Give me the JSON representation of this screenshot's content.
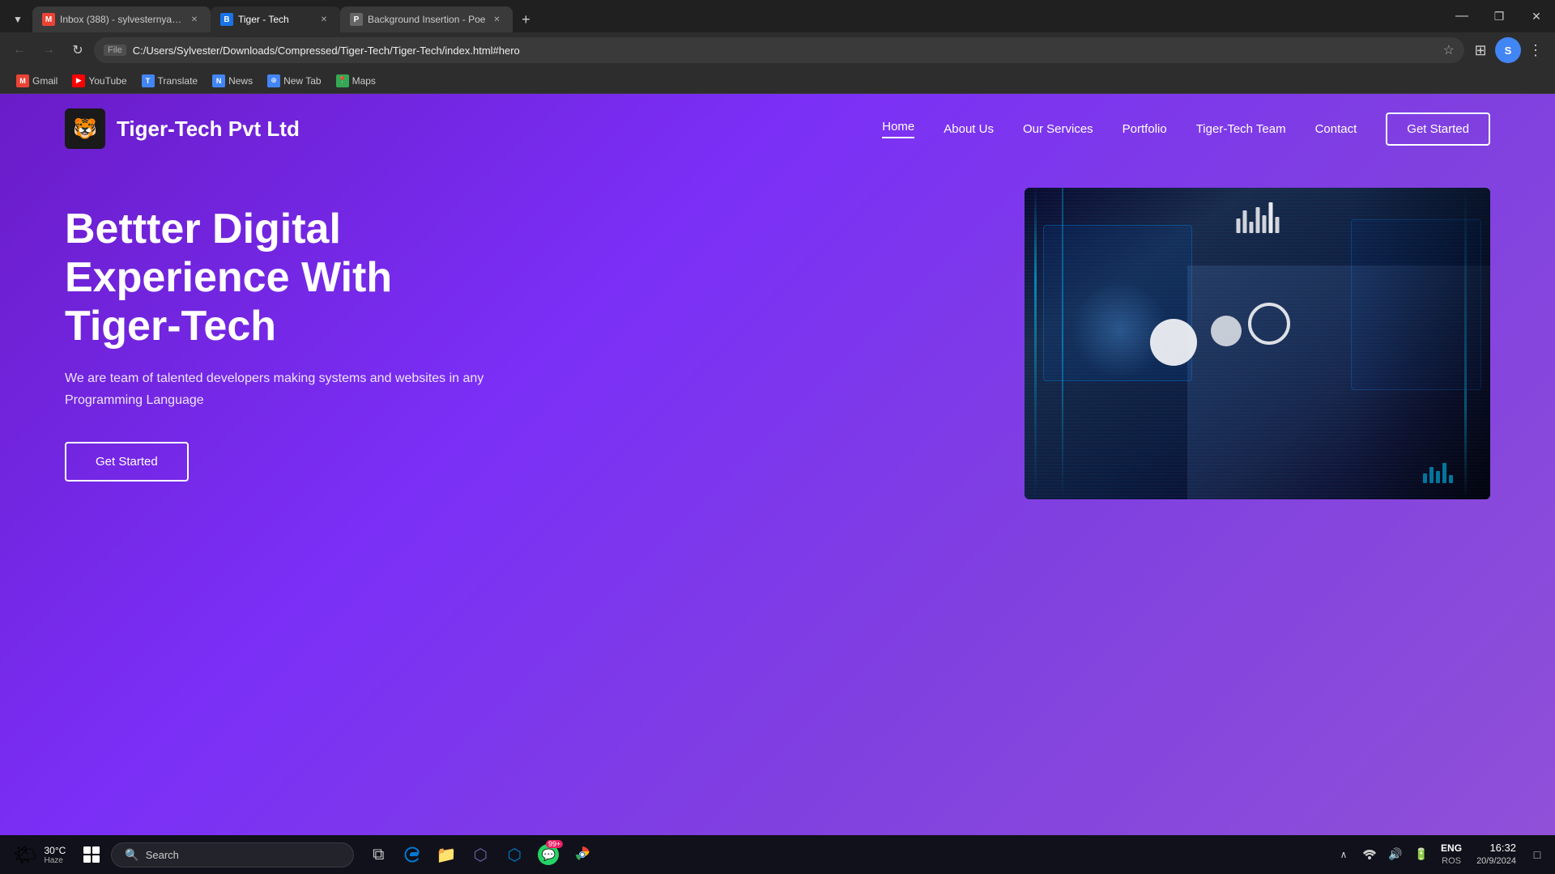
{
  "browser": {
    "tabs": [
      {
        "id": "gmail",
        "label": "Inbox (388) - sylvesternyamuru...",
        "favicon_char": "M",
        "favicon_bg": "#ea4335",
        "active": false
      },
      {
        "id": "tiger-tech",
        "label": "Tiger - Tech",
        "favicon_char": "B",
        "favicon_bg": "#1a73e8",
        "active": true
      },
      {
        "id": "background-insertion",
        "label": "Background Insertion - Poe",
        "favicon_char": "P",
        "favicon_bg": "#666",
        "active": false
      }
    ],
    "new_tab_label": "+",
    "address_bar": {
      "lock_icon": "🔒",
      "protocol": "File",
      "url": "C:/Users/Sylvester/Downloads/Compressed/Tiger-Tech/Tiger-Tech/index.html#hero"
    },
    "window_controls": {
      "minimize": "—",
      "maximize": "❐",
      "close": "✕"
    }
  },
  "bookmarks": [
    {
      "id": "gmail",
      "label": "Gmail",
      "favicon": "M",
      "color": "#ea4335"
    },
    {
      "id": "youtube",
      "label": "YouTube",
      "favicon": "▶",
      "color": "#ff0000"
    },
    {
      "id": "translate",
      "label": "Translate",
      "favicon": "T",
      "color": "#4285f4"
    },
    {
      "id": "news",
      "label": "News",
      "favicon": "N",
      "color": "#4285f4"
    },
    {
      "id": "new-tab",
      "label": "New Tab",
      "favicon": "⊕",
      "color": "#4285f4"
    },
    {
      "id": "maps",
      "label": "Maps",
      "favicon": "📍",
      "color": "#34a853"
    }
  ],
  "website": {
    "navbar": {
      "logo_text": "Tiger-Tech Pvt Ltd",
      "logo_icon": "🐯",
      "nav_links": [
        {
          "id": "home",
          "label": "Home",
          "active": true
        },
        {
          "id": "about",
          "label": "About Us",
          "active": false
        },
        {
          "id": "services",
          "label": "Our Services",
          "active": false
        },
        {
          "id": "portfolio",
          "label": "Portfolio",
          "active": false
        },
        {
          "id": "team",
          "label": "Tiger-Tech Team",
          "active": false
        },
        {
          "id": "contact",
          "label": "Contact",
          "active": false
        }
      ],
      "cta_label": "Get Started"
    },
    "hero": {
      "title": "Bettter Digital Experience With Tiger-Tech",
      "subtitle": "We are team of talented developers making systems and websites in any Programming Language",
      "cta_label": "Get Started",
      "image_alt": "Tech professionals working with digital interface"
    }
  },
  "taskbar": {
    "weather": {
      "temp": "30°C",
      "description": "Haze",
      "icon": "🌤"
    },
    "start_label": "Start",
    "search_placeholder": "Search",
    "pinned_apps": [
      {
        "id": "widgets",
        "icon": "⊞",
        "label": "Widgets"
      },
      {
        "id": "task-view",
        "icon": "⧉",
        "label": "Task View"
      },
      {
        "id": "edge",
        "icon": "◈",
        "label": "Microsoft Edge",
        "color": "#0078d4"
      },
      {
        "id": "explorer",
        "icon": "📁",
        "label": "File Explorer",
        "color": "#f5a623"
      },
      {
        "id": "teams",
        "icon": "⬡",
        "label": "Microsoft Teams",
        "color": "#6264a7"
      },
      {
        "id": "vscode",
        "icon": "⬡",
        "label": "VS Code",
        "color": "#007acc"
      },
      {
        "id": "badge99",
        "label": "99+",
        "color": "#e91e63"
      },
      {
        "id": "chrome",
        "icon": "◉",
        "label": "Chrome"
      }
    ],
    "system_tray": {
      "chevron": "∧",
      "lang": "ENG",
      "region": "ROS",
      "time": "16:32",
      "date": "20/9/2024"
    }
  }
}
